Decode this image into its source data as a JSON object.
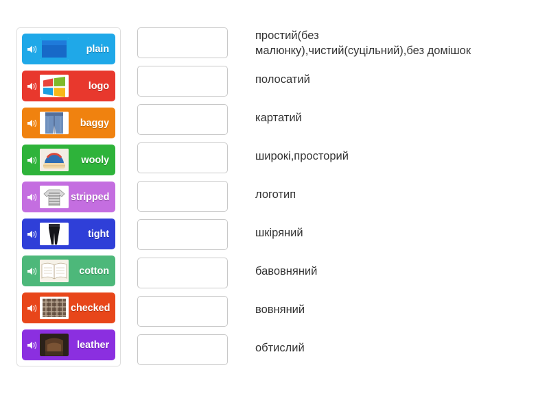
{
  "app": {
    "title": "Match-up exercise: clothes adjectives"
  },
  "cards": [
    {
      "label": "plain",
      "bg": "#1fa8e8",
      "icon": "speaker-icon",
      "thumb": "plain-blue-fabric-thumb"
    },
    {
      "label": "logo",
      "bg": "#e8382d",
      "icon": "speaker-icon",
      "thumb": "windows-logo-thumb"
    },
    {
      "label": "baggy",
      "bg": "#f0820f",
      "icon": "speaker-icon",
      "thumb": "baggy-jeans-thumb"
    },
    {
      "label": "wooly",
      "bg": "#2eb33a",
      "icon": "speaker-icon",
      "thumb": "wooly-hat-thumb"
    },
    {
      "label": "stripped",
      "bg": "#c46ee0",
      "icon": "speaker-icon",
      "thumb": "striped-sweater-thumb"
    },
    {
      "label": "tight",
      "bg": "#2f3fd8",
      "icon": "speaker-icon",
      "thumb": "tight-leggings-thumb"
    },
    {
      "label": "cotton",
      "bg": "#4db87a",
      "icon": "speaker-icon",
      "thumb": "cotton-book-thumb"
    },
    {
      "label": "checked",
      "bg": "#e8461a",
      "icon": "speaker-icon",
      "thumb": "checked-cloth-thumb"
    },
    {
      "label": "leather",
      "bg": "#8b2fe0",
      "icon": "speaker-icon",
      "thumb": "leather-chair-thumb"
    }
  ],
  "rows": [
    {
      "text": "простий(без\nмалюнку),чистий(суцільний),без домішок",
      "slot_value": "",
      "tall": true
    },
    {
      "text": "полосатий",
      "slot_value": "",
      "tall": false
    },
    {
      "text": "картатий",
      "slot_value": "",
      "tall": false
    },
    {
      "text": "широкі,просторий",
      "slot_value": "",
      "tall": false
    },
    {
      "text": "логотип",
      "slot_value": "",
      "tall": false
    },
    {
      "text": "шкіряний",
      "slot_value": "",
      "tall": false
    },
    {
      "text": "бавовняний",
      "slot_value": "",
      "tall": false
    },
    {
      "text": "вовняний",
      "slot_value": "",
      "tall": false
    },
    {
      "text": "обтислий",
      "slot_value": "",
      "tall": false
    }
  ],
  "colors": {
    "page_bg": "#ffffff",
    "panel_border": "#dddddd",
    "slot_border": "#c8c8c8",
    "text": "#333333"
  }
}
